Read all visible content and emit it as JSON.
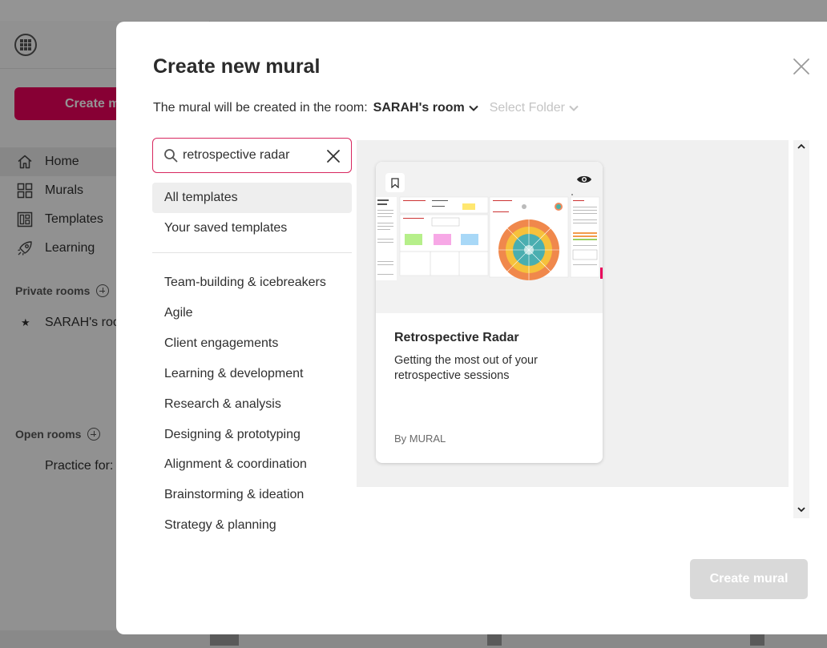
{
  "background_app": {
    "create_button_label": "Create m",
    "nav": [
      {
        "label": "Home",
        "icon": "home-icon"
      },
      {
        "label": "Murals",
        "icon": "grid-icon"
      },
      {
        "label": "Templates",
        "icon": "templates-icon"
      },
      {
        "label": "Learning",
        "icon": "rocket-icon"
      }
    ],
    "private_rooms_label": "Private rooms",
    "private_room_item": "SARAH's roo",
    "open_rooms_label": "Open rooms",
    "open_room_item": "Practice for:"
  },
  "modal": {
    "title": "Create new mural",
    "room_prefix": "The mural will be created in the room:",
    "room_name": "SARAH's room",
    "folder_placeholder": "Select Folder",
    "search": {
      "value": "retrospective radar"
    },
    "filters": [
      {
        "label": "All templates",
        "active": true
      },
      {
        "label": "Your saved templates",
        "active": false
      }
    ],
    "categories": [
      "Team-building & icebreakers",
      "Agile",
      "Client engagements",
      "Learning & development",
      "Research & analysis",
      "Designing & prototyping",
      "Alignment & coordination",
      "Brainstorming & ideation",
      "Strategy & planning"
    ],
    "template_card": {
      "title": "Retrospective Radar",
      "description": "Getting the most out of your retrospective sessions",
      "author": "By MURAL",
      "thumbnail_heading": "Retrospective Radar"
    },
    "create_button_label": "Create mural"
  },
  "colors": {
    "brand_pink": "#e8005a",
    "search_border": "#d8275f",
    "disabled_button": "#d9d9d9"
  }
}
